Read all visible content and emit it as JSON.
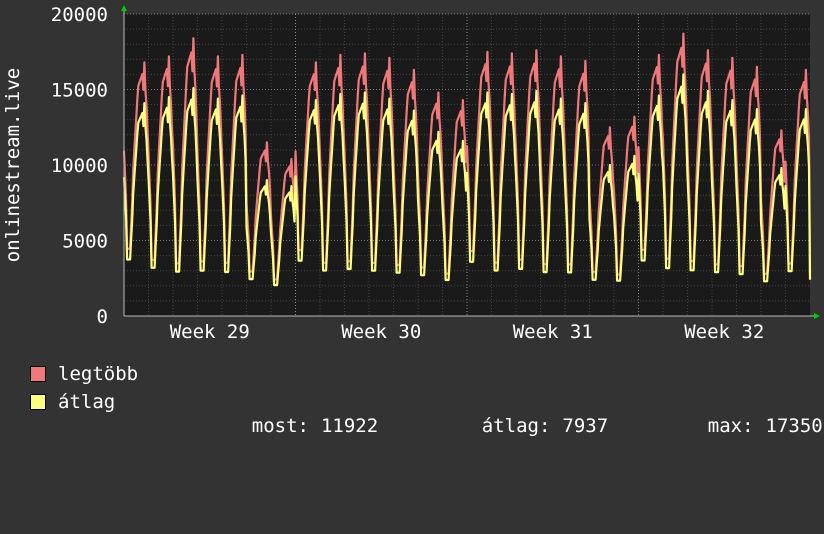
{
  "chart_data": {
    "type": "area",
    "ylabel": "onlinestream.live",
    "ylim": [
      0,
      20000
    ],
    "yticks": [
      0,
      5000,
      10000,
      15000,
      20000
    ],
    "xlabels": [
      "Week 29",
      "Week 30",
      "Week 31",
      "Week 32"
    ],
    "x_domain_days": 28,
    "week_label_days": [
      3.5,
      10.5,
      17.5,
      24.5
    ],
    "grid": true,
    "colors": {
      "background": "#333333",
      "plot": "#1a1a1a",
      "grid": "#555555",
      "max_series": "#f07878",
      "avg_series": "#ffff80",
      "text": "#ffffff",
      "arrow": "#00cc00"
    },
    "series": [
      {
        "name": "legtöbb",
        "color": "#f07878",
        "daily_peak": [
          16800,
          17200,
          18400,
          17200,
          17300,
          11500,
          10400,
          16800,
          17300,
          17400,
          17100,
          16300,
          14800,
          14300,
          17500,
          17400,
          17600,
          17200,
          16900,
          12500,
          13200,
          17300,
          18700,
          17600,
          17100,
          16500,
          12300,
          16300
        ],
        "daily_trough": [
          3800,
          3000,
          2700,
          2900,
          2800,
          2500,
          2000,
          3700,
          2800,
          2900,
          2800,
          2700,
          2600,
          2200,
          3600,
          2800,
          3000,
          2700,
          2700,
          2400,
          2200,
          3700,
          3000,
          2900,
          2700,
          2600,
          2300,
          2800
        ]
      },
      {
        "name": "átlag",
        "color": "#ffff80",
        "daily_peak": [
          14100,
          14500,
          15100,
          14400,
          14600,
          9000,
          8600,
          14300,
          14700,
          14800,
          14400,
          13600,
          12200,
          11600,
          14800,
          14700,
          14900,
          14400,
          14100,
          10000,
          10600,
          14600,
          16000,
          14900,
          14300,
          13700,
          9800,
          13700
        ],
        "daily_trough": [
          3200,
          2600,
          2300,
          2400,
          2300,
          2100,
          1700,
          3100,
          2400,
          2500,
          2400,
          2300,
          2200,
          1900,
          3000,
          2400,
          2500,
          2300,
          2300,
          2000,
          1900,
          3100,
          2500,
          2400,
          2300,
          2200,
          1900,
          2400
        ]
      }
    ]
  },
  "legend": {
    "max_label": "legtöbb",
    "avg_label": "átlag",
    "now_label": "most:",
    "now_value": "11922",
    "avg_stat_label": "átlag:",
    "avg_stat_value": "7937",
    "max_stat_label": "max:",
    "max_stat_value": "17350"
  }
}
